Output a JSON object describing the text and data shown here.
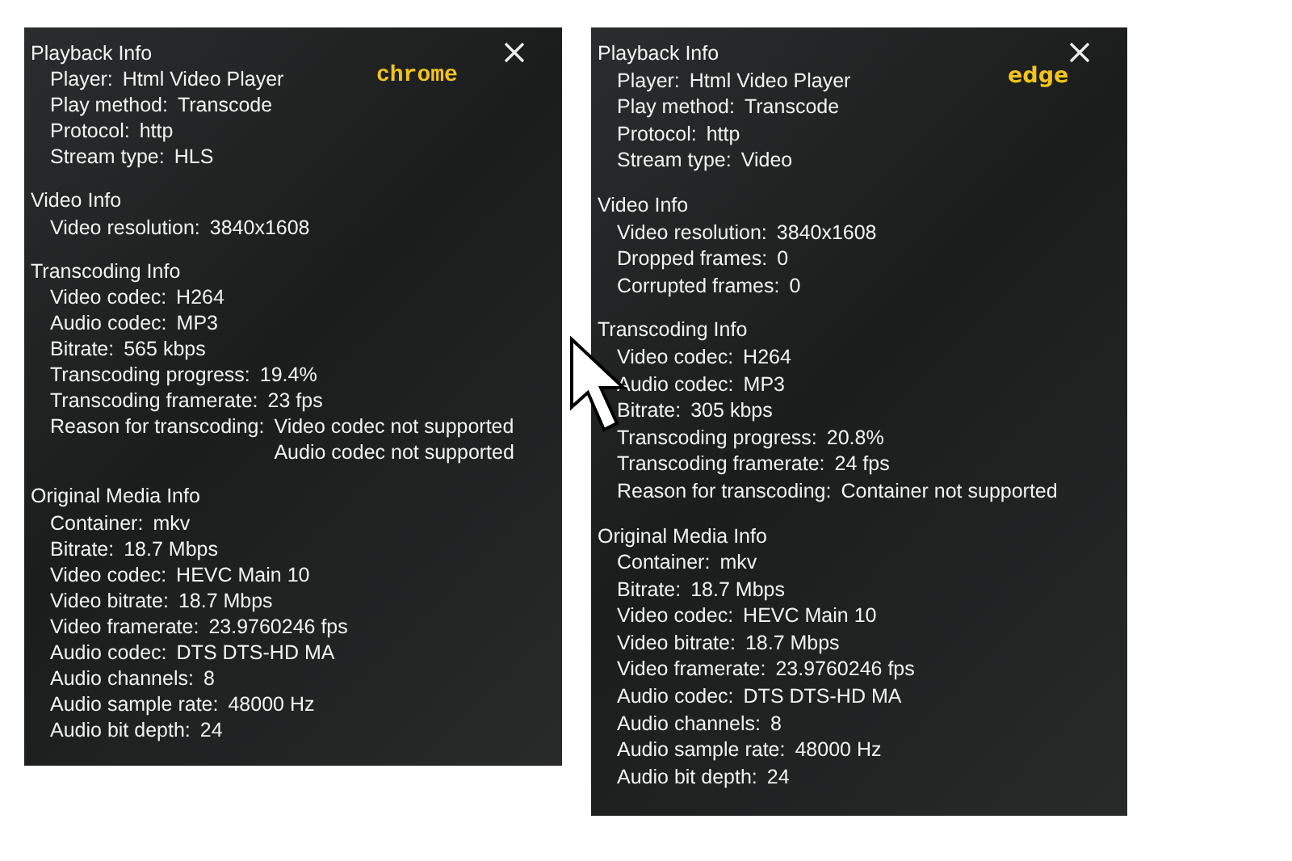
{
  "panels": [
    {
      "annotation": "chrome",
      "sections": [
        {
          "title": "Playback Info",
          "rows": [
            {
              "label": "Player:",
              "values": [
                "Html Video Player"
              ]
            },
            {
              "label": "Play method:",
              "values": [
                "Transcode"
              ]
            },
            {
              "label": "Protocol:",
              "values": [
                "http"
              ]
            },
            {
              "label": "Stream type:",
              "values": [
                "HLS"
              ]
            }
          ]
        },
        {
          "title": "Video Info",
          "rows": [
            {
              "label": "Video resolution:",
              "values": [
                "3840x1608"
              ]
            }
          ]
        },
        {
          "title": "Transcoding Info",
          "rows": [
            {
              "label": "Video codec:",
              "values": [
                "H264"
              ]
            },
            {
              "label": "Audio codec:",
              "values": [
                "MP3"
              ]
            },
            {
              "label": "Bitrate:",
              "values": [
                "565 kbps"
              ]
            },
            {
              "label": "Transcoding progress:",
              "values": [
                "19.4%"
              ]
            },
            {
              "label": "Transcoding framerate:",
              "values": [
                "23 fps"
              ]
            },
            {
              "label": "Reason for transcoding:",
              "values": [
                "Video codec not supported",
                "Audio codec not supported"
              ]
            }
          ]
        },
        {
          "title": "Original Media Info",
          "rows": [
            {
              "label": "Container:",
              "values": [
                "mkv"
              ]
            },
            {
              "label": "Bitrate:",
              "values": [
                "18.7 Mbps"
              ]
            },
            {
              "label": "Video codec:",
              "values": [
                "HEVC Main 10"
              ]
            },
            {
              "label": "Video bitrate:",
              "values": [
                "18.7 Mbps"
              ]
            },
            {
              "label": "Video framerate:",
              "values": [
                "23.9760246 fps"
              ]
            },
            {
              "label": "Audio codec:",
              "values": [
                "DTS DTS-HD MA"
              ]
            },
            {
              "label": "Audio channels:",
              "values": [
                "8"
              ]
            },
            {
              "label": "Audio sample rate:",
              "values": [
                "48000 Hz"
              ]
            },
            {
              "label": "Audio bit depth:",
              "values": [
                "24"
              ]
            }
          ]
        }
      ]
    },
    {
      "annotation": "edge",
      "sections": [
        {
          "title": "Playback Info",
          "rows": [
            {
              "label": "Player:",
              "values": [
                "Html Video Player"
              ]
            },
            {
              "label": "Play method:",
              "values": [
                "Transcode"
              ]
            },
            {
              "label": "Protocol:",
              "values": [
                "http"
              ]
            },
            {
              "label": "Stream type:",
              "values": [
                "Video"
              ]
            }
          ]
        },
        {
          "title": "Video Info",
          "rows": [
            {
              "label": "Video resolution:",
              "values": [
                "3840x1608"
              ]
            },
            {
              "label": "Dropped frames:",
              "values": [
                "0"
              ]
            },
            {
              "label": "Corrupted frames:",
              "values": [
                "0"
              ]
            }
          ]
        },
        {
          "title": "Transcoding Info",
          "rows": [
            {
              "label": "Video codec:",
              "values": [
                "H264"
              ]
            },
            {
              "label": "Audio codec:",
              "values": [
                "MP3"
              ]
            },
            {
              "label": "Bitrate:",
              "values": [
                "305 kbps"
              ]
            },
            {
              "label": "Transcoding progress:",
              "values": [
                "20.8%"
              ]
            },
            {
              "label": "Transcoding framerate:",
              "values": [
                "24 fps"
              ]
            },
            {
              "label": "Reason for transcoding:",
              "values": [
                "Container not supported"
              ]
            }
          ]
        },
        {
          "title": "Original Media Info",
          "rows": [
            {
              "label": "Container:",
              "values": [
                "mkv"
              ]
            },
            {
              "label": "Bitrate:",
              "values": [
                "18.7 Mbps"
              ]
            },
            {
              "label": "Video codec:",
              "values": [
                "HEVC Main 10"
              ]
            },
            {
              "label": "Video bitrate:",
              "values": [
                "18.7 Mbps"
              ]
            },
            {
              "label": "Video framerate:",
              "values": [
                "23.9760246 fps"
              ]
            },
            {
              "label": "Audio codec:",
              "values": [
                "DTS DTS-HD MA"
              ]
            },
            {
              "label": "Audio channels:",
              "values": [
                "8"
              ]
            },
            {
              "label": "Audio sample rate:",
              "values": [
                "48000 Hz"
              ]
            },
            {
              "label": "Audio bit depth:",
              "values": [
                "24"
              ]
            }
          ]
        }
      ]
    }
  ]
}
